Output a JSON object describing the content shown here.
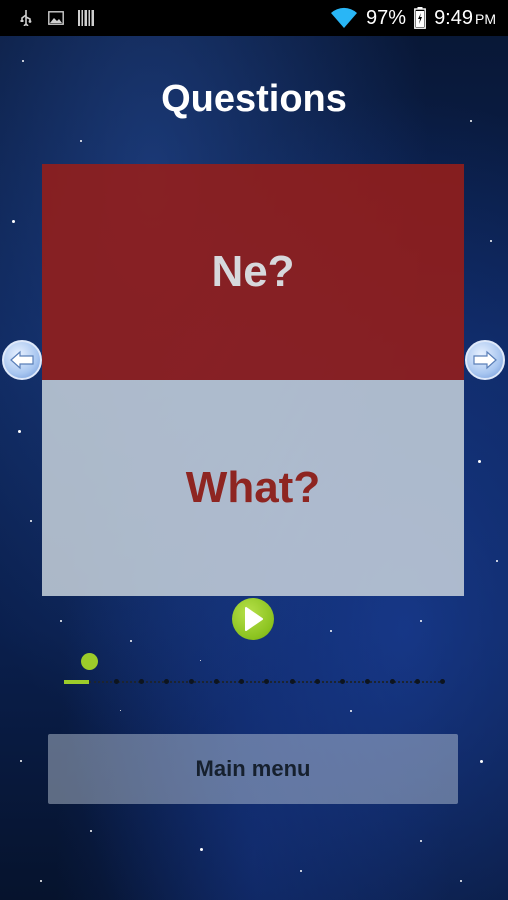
{
  "status_bar": {
    "battery": "97%",
    "time": "9:49",
    "ampm": "PM",
    "icons": [
      "usb-icon",
      "image-icon",
      "barcode-icon",
      "wifi-icon",
      "battery-icon"
    ]
  },
  "page": {
    "title": "Questions"
  },
  "card": {
    "native_word": "Ne?",
    "translation": "What?"
  },
  "progress": {
    "current": 1,
    "total": 16
  },
  "buttons": {
    "main_menu": "Main menu"
  },
  "colors": {
    "accent_green": "#9ccc2a",
    "card_red": "#961e19",
    "card_gray": "#c8d2dc",
    "translation_red": "#8e2521"
  }
}
